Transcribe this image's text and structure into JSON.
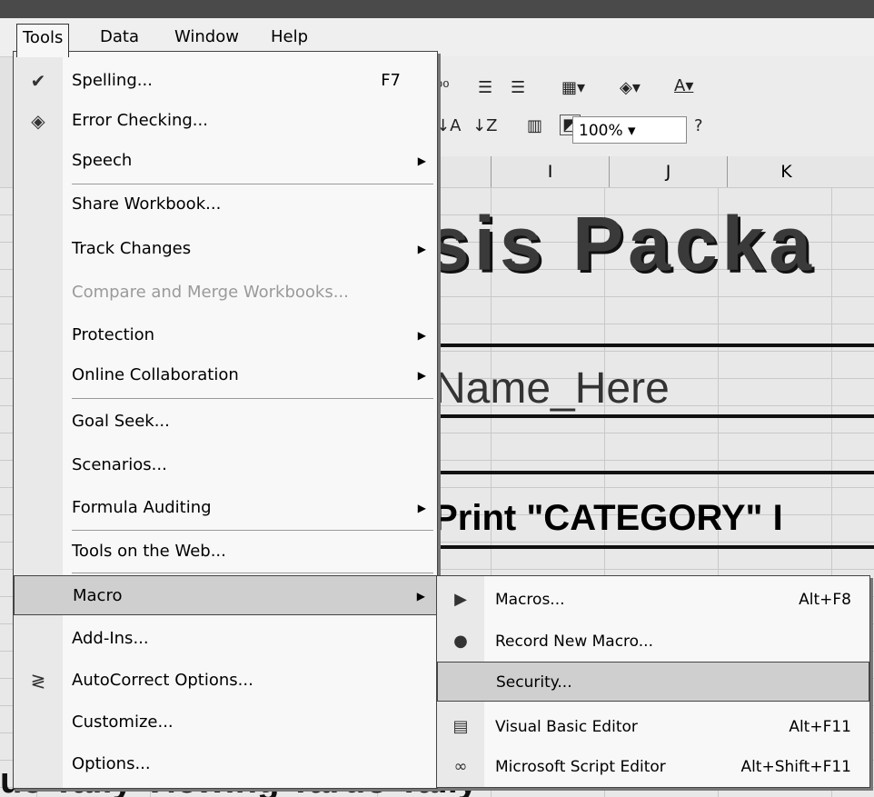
{
  "menubar": [
    {
      "label": "Tools"
    },
    {
      "label": "Data"
    },
    {
      "label": "Window"
    },
    {
      "label": "Help"
    }
  ],
  "toolbar": {
    "zoom": "100%"
  },
  "columns": [
    "I",
    "J",
    "K"
  ],
  "sheet": {
    "title_fragment": "sis Packa",
    "name_fragment": "Name_Here",
    "category_fragment": "/Print \"CATEGORY\" I",
    "footer_fragment": "ue Tally     Viewing  Tardo Tally"
  },
  "tools_menu": [
    {
      "label": "Spelling...",
      "shortcut": "F7",
      "icon": "spelling-icon"
    },
    {
      "label": "Error Checking...",
      "icon": "error-checking-icon"
    },
    {
      "label": "Speech"
    },
    {
      "label": "Share Workbook..."
    },
    {
      "label": "Track Changes"
    },
    {
      "label": "Compare and Merge Workbooks..."
    },
    {
      "label": "Protection"
    },
    {
      "label": "Online Collaboration"
    },
    {
      "label": "Goal Seek..."
    },
    {
      "label": "Scenarios..."
    },
    {
      "label": "Formula Auditing"
    },
    {
      "label": "Tools on the Web..."
    },
    {
      "label": "Macro"
    },
    {
      "label": "Add-Ins..."
    },
    {
      "label": "AutoCorrect Options...",
      "icon": "autocorrect-icon"
    },
    {
      "label": "Customize..."
    },
    {
      "label": "Options..."
    }
  ],
  "macro_submenu": [
    {
      "label": "Macros...",
      "shortcut": "Alt+F8",
      "icon": "play-icon"
    },
    {
      "label": "Record New Macro...",
      "icon": "record-icon"
    },
    {
      "label": "Security..."
    },
    {
      "label": "Visual Basic Editor",
      "shortcut": "Alt+F11",
      "icon": "vb-editor-icon"
    },
    {
      "label": "Microsoft Script Editor",
      "shortcut": "Alt+Shift+F11",
      "icon": "script-editor-icon"
    }
  ]
}
